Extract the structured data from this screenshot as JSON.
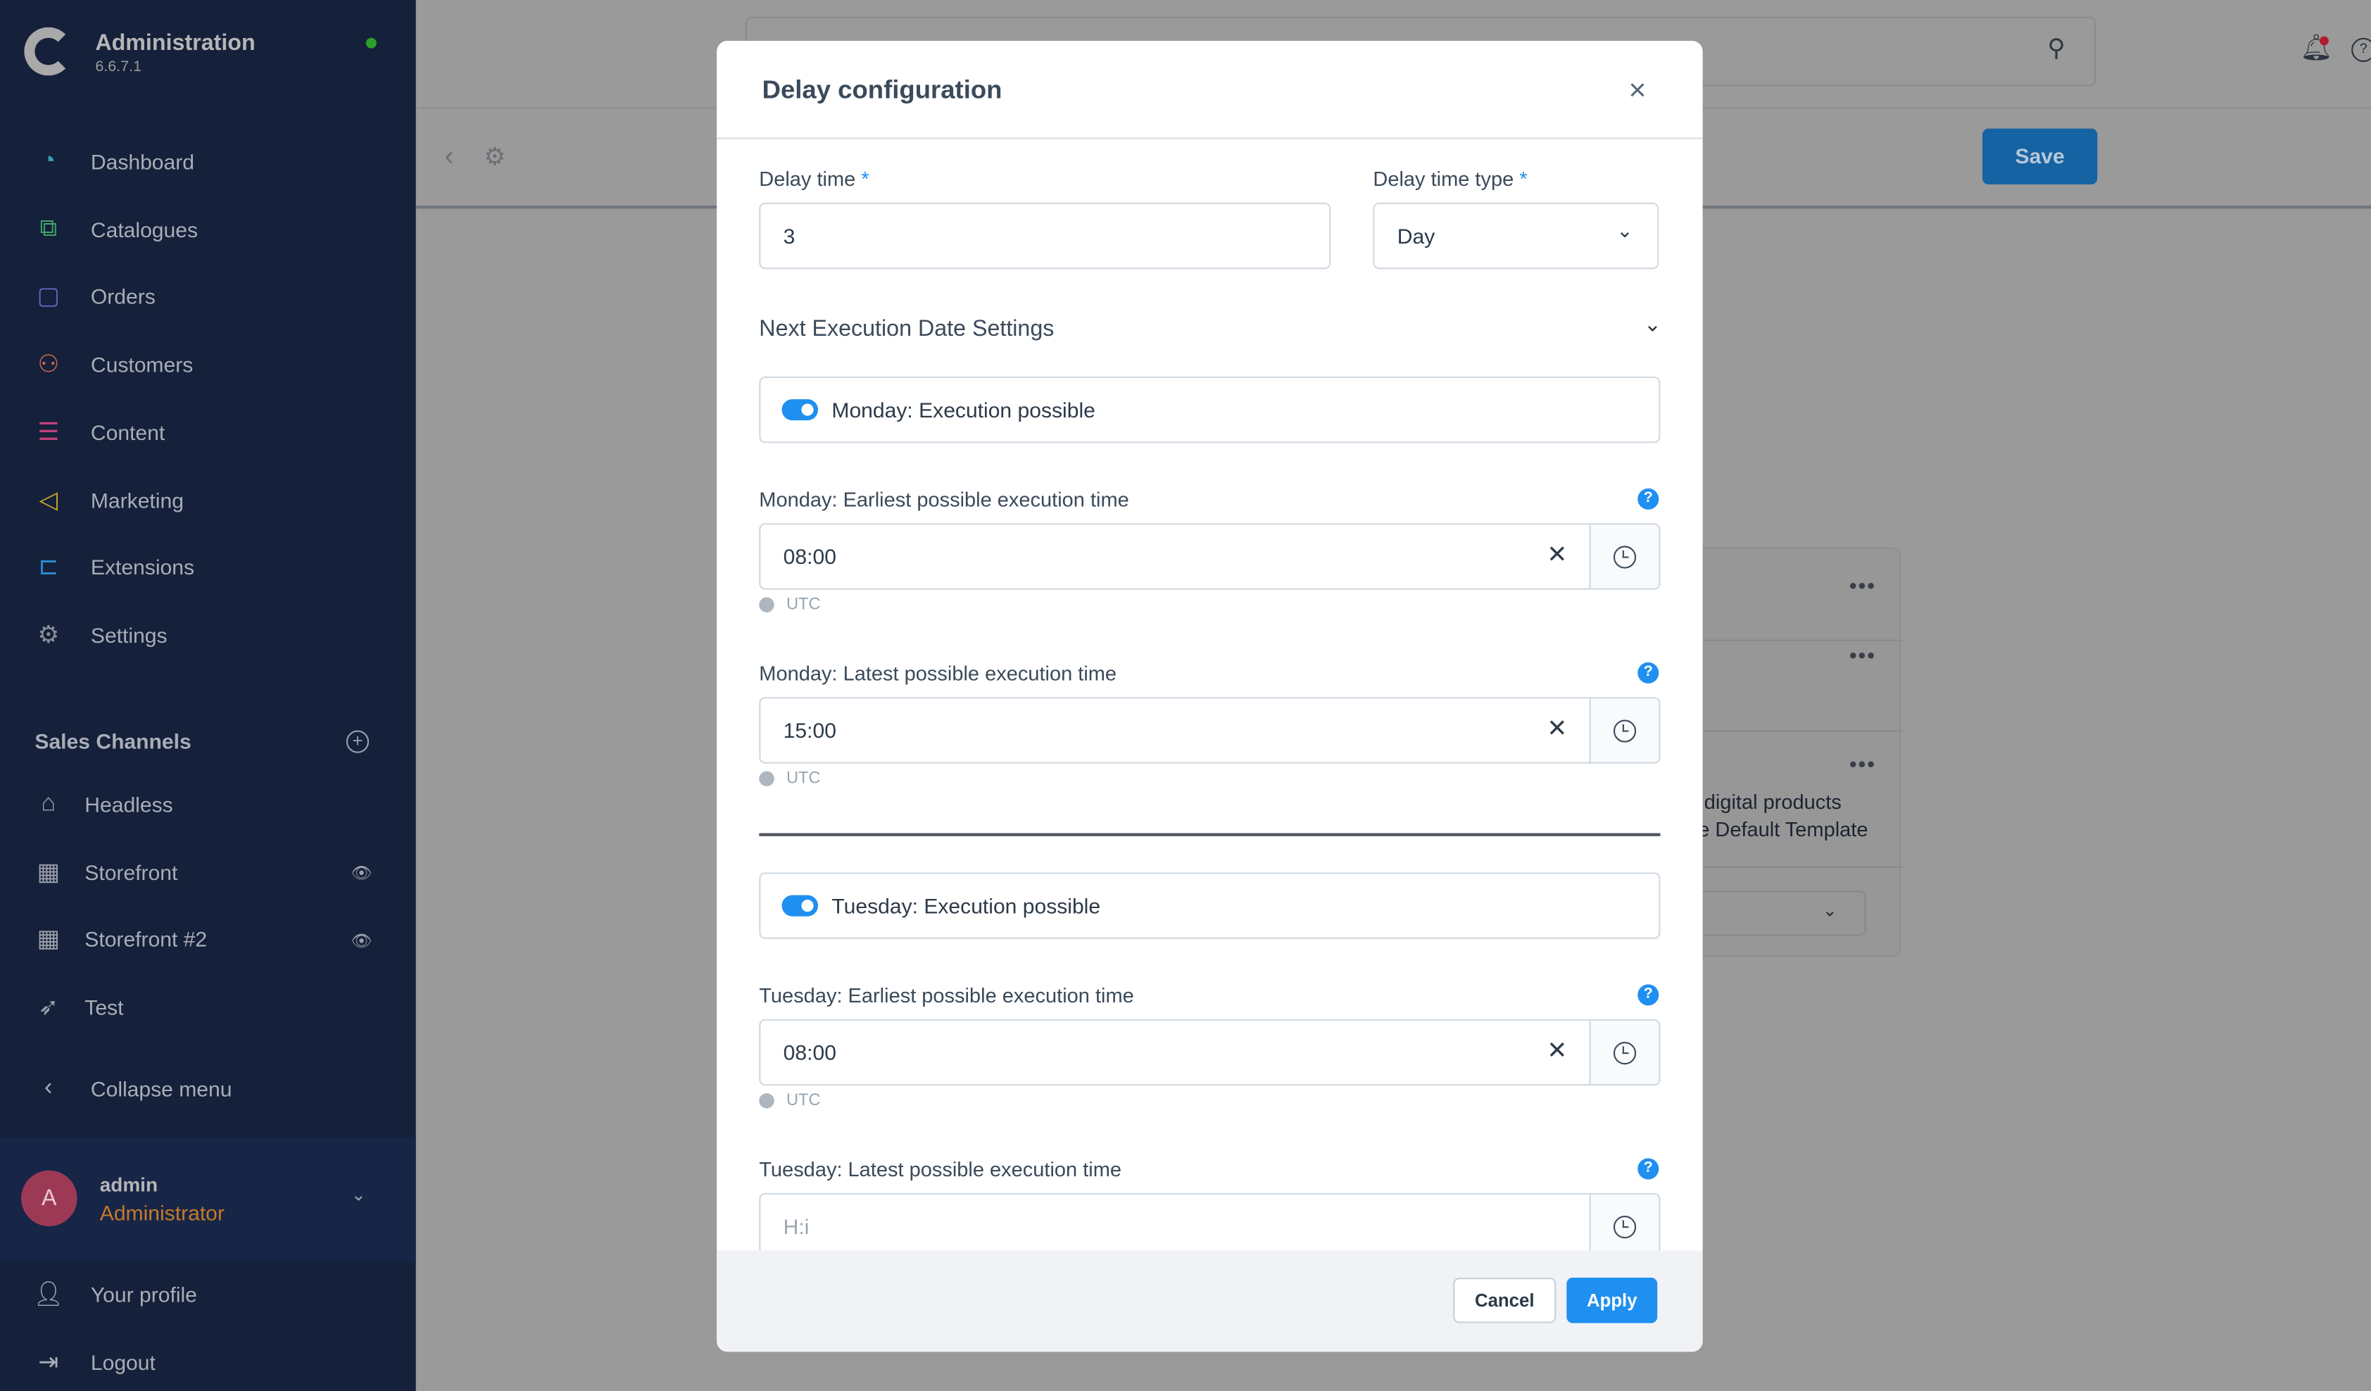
{
  "app": {
    "title": "Administration",
    "version": "6.6.7.1"
  },
  "sidebar": {
    "items": [
      {
        "label": "Dashboard",
        "icon": "gauge-icon",
        "color": "#3aa0b8"
      },
      {
        "label": "Catalogues",
        "icon": "catalogue-icon",
        "color": "#3fa56a"
      },
      {
        "label": "Orders",
        "icon": "bag-icon",
        "color": "#6b5fc7"
      },
      {
        "label": "Customers",
        "icon": "users-icon",
        "color": "#d06a4a"
      },
      {
        "label": "Content",
        "icon": "content-icon",
        "color": "#c0407a"
      },
      {
        "label": "Marketing",
        "icon": "megaphone-icon",
        "color": "#c9a62a"
      },
      {
        "label": "Extensions",
        "icon": "plug-icon",
        "color": "#2a8ac9"
      },
      {
        "label": "Settings",
        "icon": "gear-icon",
        "color": "#8a8f98"
      }
    ],
    "sales_channels_title": "Sales Channels",
    "channels": [
      {
        "label": "Headless",
        "icon": "basket-icon"
      },
      {
        "label": "Storefront",
        "icon": "store-icon"
      },
      {
        "label": "Storefront #2",
        "icon": "store-icon"
      },
      {
        "label": "Test",
        "icon": "rocket-icon"
      }
    ],
    "collapse": "Collapse menu",
    "user": {
      "initial": "A",
      "name": "admin",
      "role": "Administrator"
    },
    "profile": "Your profile",
    "logout": "Logout"
  },
  "toolbar": {
    "save": "Save"
  },
  "background": {
    "line1": "digital products",
    "line2": "e Default Template"
  },
  "modal": {
    "title": "Delay configuration",
    "delay_time_label": "Delay time",
    "delay_time": "3",
    "delay_type_label": "Delay time type",
    "delay_type": "Day",
    "section": "Next Execution Date Settings",
    "monday_toggle": "Monday: Execution possible",
    "mon_earliest_label": "Monday: Earliest possible execution time",
    "mon_earliest": "08:00",
    "mon_latest_label": "Monday: Latest possible execution time",
    "mon_latest": "15:00",
    "tuesday_toggle": "Tuesday: Execution possible",
    "tue_earliest_label": "Tuesday: Earliest possible execution time",
    "tue_earliest": "08:00",
    "tue_latest_label": "Tuesday: Latest possible execution time",
    "tue_latest_placeholder": "H:i",
    "utc": "UTC",
    "required": "*",
    "help": "?",
    "cancel": "Cancel",
    "apply": "Apply"
  }
}
